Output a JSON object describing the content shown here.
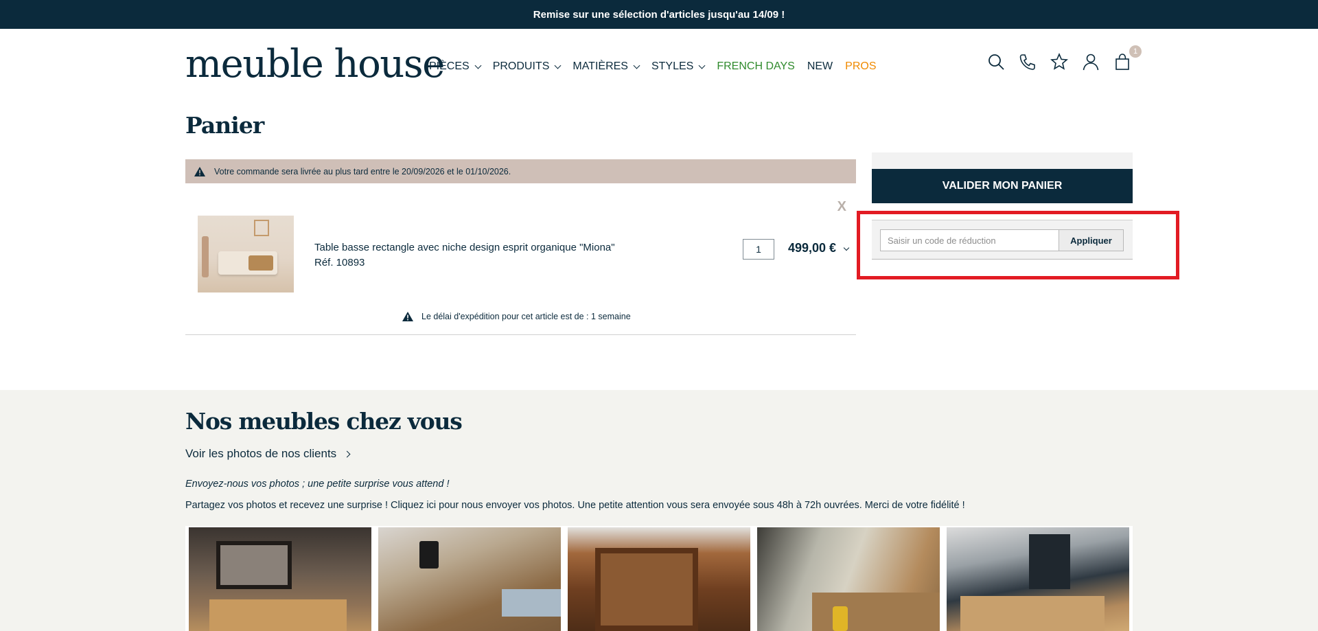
{
  "topbar": {
    "promo_text": "Remise sur une sélection d'articles jusqu'au 14/09 !"
  },
  "header": {
    "logo": "meuble house",
    "nav": [
      {
        "label": "PIÈCES",
        "dropdown": true
      },
      {
        "label": "PRODUITS",
        "dropdown": true
      },
      {
        "label": "MATIÈRES",
        "dropdown": true
      },
      {
        "label": "STYLES",
        "dropdown": true
      },
      {
        "label": "FRENCH DAYS",
        "color": "#2f8a2c"
      },
      {
        "label": "NEW"
      },
      {
        "label": "PROS",
        "color": "#f08a00"
      }
    ],
    "icons": [
      "search-icon",
      "phone-icon",
      "star-icon",
      "user-icon",
      "cart-icon"
    ],
    "cart_count": "1"
  },
  "cart": {
    "title": "Panier",
    "delivery_notice": "Votre commande sera livrée au plus tard entre le 20/09/2026 et le 01/10/2026.",
    "remove_label": "X",
    "item": {
      "name": "Table basse rectangle avec niche design esprit organique \"Miona\"",
      "ref": "Réf. 10893",
      "quantity": "1",
      "price": "499,00 €",
      "shipping_note": "Le délai d'expédition pour cet article est de : 1 semaine"
    }
  },
  "summary": {
    "validate_label": "VALIDER MON PANIER",
    "promo_placeholder": "Saisir un code de réduction",
    "promo_value": "",
    "apply_label": "Appliquer",
    "highlight_color": "#e21b23"
  },
  "gallery": {
    "title": "Nos meubles chez vous",
    "link": "Voir les photos de nos clients",
    "italic_text": "Envoyez-nous vos photos ; une petite surprise vous attend !",
    "text": "Partagez vos photos et recevez une surprise ! Cliquez ici pour nous envoyer vos photos. Une petite attention vous sera envoyée sous 48h à 72h ouvrées. Merci de votre fidélité !"
  },
  "colors": {
    "brand": "#0b2a3c",
    "banner": "#cfbfb7",
    "accent_green": "#2f8a2c",
    "accent_orange": "#f08a00"
  }
}
